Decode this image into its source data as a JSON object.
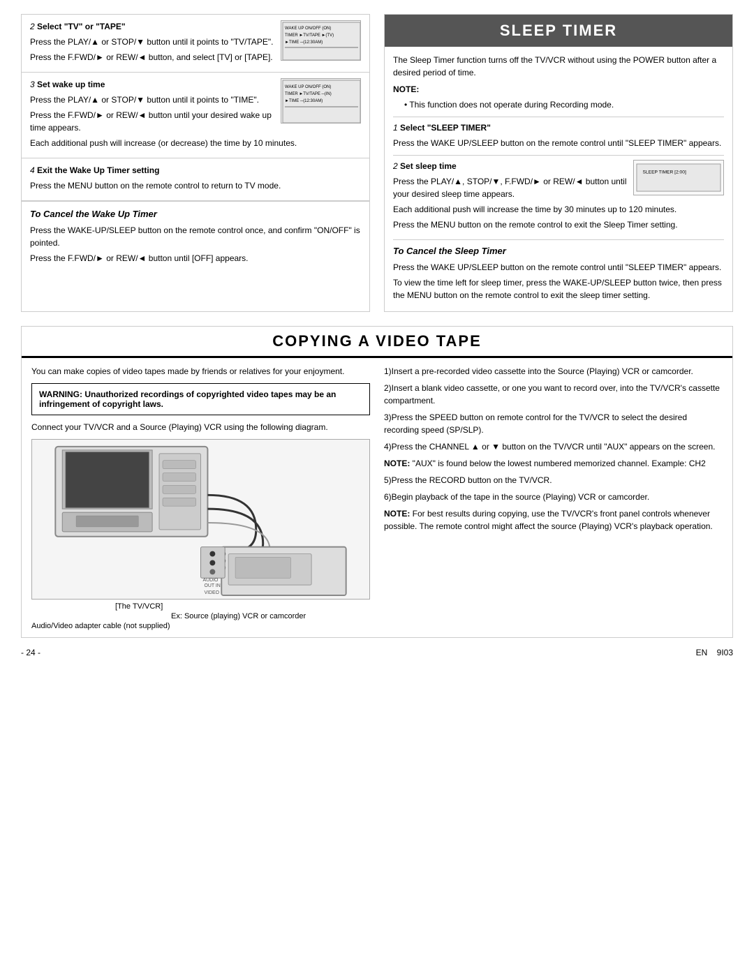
{
  "page": {
    "title": "SLEEP TIMER",
    "copying_title": "COPYING A VIDEO TAPE",
    "footer_page": "- 24 -",
    "footer_lang": "EN",
    "footer_code": "9I03"
  },
  "left_col": {
    "step2": {
      "number": "2",
      "title": "Select \"TV\" or \"TAPE\"",
      "text1": "Press the PLAY/▲ or STOP/▼ button until it points to \"TV/TAPE\".",
      "text2": "Press the F.FWD/► or REW/◄ button, and select [TV] or [TAPE]."
    },
    "step3": {
      "number": "3",
      "title": "Set wake up time",
      "text1": "Press the PLAY/▲ or STOP/▼ button until it points to \"TIME\".",
      "text2": "Press the F.FWD/► or REW/◄ button until your desired wake up time appears.",
      "text3": "Each additional push will increase (or decrease) the time by 10 minutes."
    },
    "step4": {
      "number": "4",
      "title": "Exit the Wake Up Timer setting",
      "text1": "Press the MENU button on the remote control to return to TV mode."
    },
    "cancel": {
      "title": "To Cancel the Wake Up Timer",
      "text1": "Press the WAKE-UP/SLEEP button on the remote control once, and confirm \"ON/OFF\" is pointed.",
      "text2": "Press the F.FWD/► or REW/◄ button until [OFF] appears."
    }
  },
  "right_col": {
    "intro": "The Sleep Timer function turns off the TV/VCR without using the POWER button after a desired period of time.",
    "note_label": "NOTE:",
    "note_bullet": "This function does not operate during Recording mode.",
    "step1": {
      "number": "1",
      "title": "Select \"SLEEP TIMER\"",
      "text1": "Press the WAKE UP/SLEEP button on the remote control until \"SLEEP TIMER\" appears."
    },
    "step2": {
      "number": "2",
      "title": "Set sleep time",
      "text1": "Press the PLAY/▲, STOP/▼, F.FWD/► or REW/◄ button until your desired sleep time appears.",
      "text2": "Each additional push will increase the time by 30 minutes up to 120 minutes.",
      "text3": "Press the MENU button on the remote control to exit the Sleep Timer setting."
    },
    "cancel": {
      "title": "To Cancel the Sleep Timer",
      "text1": "Press the WAKE UP/SLEEP button on the remote control until \"SLEEP TIMER\" appears.",
      "text2": "To view the time left for sleep timer, press the WAKE-UP/SLEEP button twice, then press the MENU button on the remote control to exit the sleep timer setting."
    }
  },
  "copying": {
    "title": "COPYING A VIDEO TAPE",
    "intro": "You can make copies of video tapes made by friends or relatives for your enjoyment.",
    "warning": {
      "text": "WARNING: Unauthorized recordings of copyrighted video tapes may be an infringement of copyright laws."
    },
    "connect_text": "Connect your TV/VCR and a Source (Playing) VCR using the following diagram.",
    "vcr_label": "[The TV/VCR]",
    "source_label": "Ex: Source (playing) VCR or camcorder",
    "cable_label": "Audio/Video adapter cable (not supplied)",
    "steps": [
      "1)Insert a pre-recorded video cassette into the Source (Playing) VCR or camcorder.",
      "2)Insert a blank video cassette, or one you want to record over, into the TV/VCR's cassette compartment.",
      "3)Press the SPEED button on remote control for the TV/VCR to select the desired recording speed (SP/SLP).",
      "4)Press the CHANNEL ▲ or ▼ button on the TV/VCR until \"AUX\" appears on the screen.",
      "5)Press the RECORD button on the TV/VCR.",
      "6)Begin playback of the tape in the source (Playing) VCR or camcorder."
    ],
    "note1": "NOTE: \"AUX\" is found below the lowest numbered memorized channel. Example: CH2",
    "note2": "NOTE: For best results during copying, use the TV/VCR's front panel controls whenever possible. The remote control might affect the source (Playing) VCR's playback operation."
  }
}
